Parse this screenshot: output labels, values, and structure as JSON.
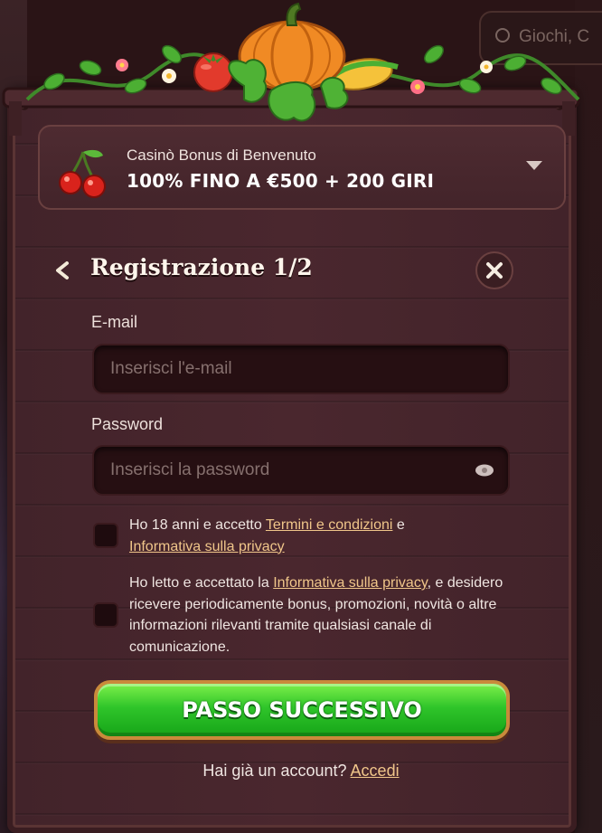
{
  "background": {
    "search_placeholder": "Giochi, C",
    "colors": {
      "wood": "#4a272e",
      "accent_gold": "#f0c68a",
      "cta_green": "#2fc52a"
    }
  },
  "bonus": {
    "subtitle": "Casinò Bonus di Benvenuto",
    "offer": "100% FINO A €500 + 200 GIRI",
    "icon": "cherry-icon"
  },
  "form": {
    "title": "Registrazione 1/2",
    "email": {
      "label": "E-mail",
      "placeholder": "Inserisci l'e-mail",
      "value": ""
    },
    "password": {
      "label": "Password",
      "placeholder": "Inserisci la password",
      "value": ""
    },
    "consent_age": {
      "checked": false,
      "text_before": "Ho 18 anni e accetto ",
      "link_terms": "Termini e condizioni",
      "text_mid": " e ",
      "link_privacy": "Informativa sulla privacy"
    },
    "consent_marketing": {
      "checked": false,
      "text_before": "Ho letto e accettato la ",
      "link_privacy": "Informativa sulla privacy",
      "text_after": ", e desidero ricevere periodicamente bonus, promozioni, novità o altre informazioni rilevanti tramite qualsiasi canale di comunicazione."
    },
    "submit_label": "PASSO SUCCESSIVO",
    "login_prompt": "Hai già un account? ",
    "login_link": "Accedi"
  }
}
